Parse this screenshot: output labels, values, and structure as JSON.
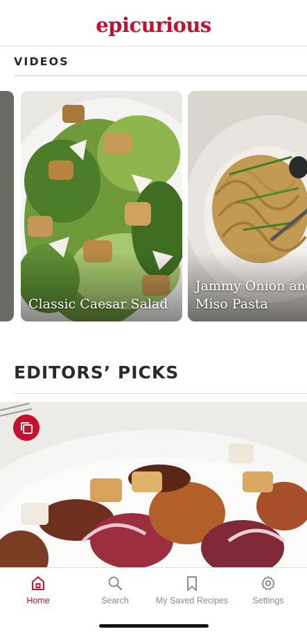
{
  "app": {
    "logo_text": "epicurious",
    "brand_color": "#c8102e"
  },
  "videos": {
    "label": "VIDEOS",
    "cards": [
      {
        "title": "Classic Caesar Salad"
      },
      {
        "title": "Jammy Onion and Miso Pasta",
        "title_lines": [
          "Jammy Onion and",
          "Miso Pasta"
        ]
      }
    ]
  },
  "editors_picks": {
    "title": "EDITORS’ PICKS",
    "badge_icon": "gallery-icon"
  },
  "tabs": [
    {
      "label": "Home",
      "icon": "home-icon",
      "active": true
    },
    {
      "label": "Search",
      "icon": "search-icon",
      "active": false
    },
    {
      "label": "My Saved Recipes",
      "icon": "bookmark-icon",
      "active": false
    },
    {
      "label": "Settings",
      "icon": "gear-icon",
      "active": false
    }
  ]
}
